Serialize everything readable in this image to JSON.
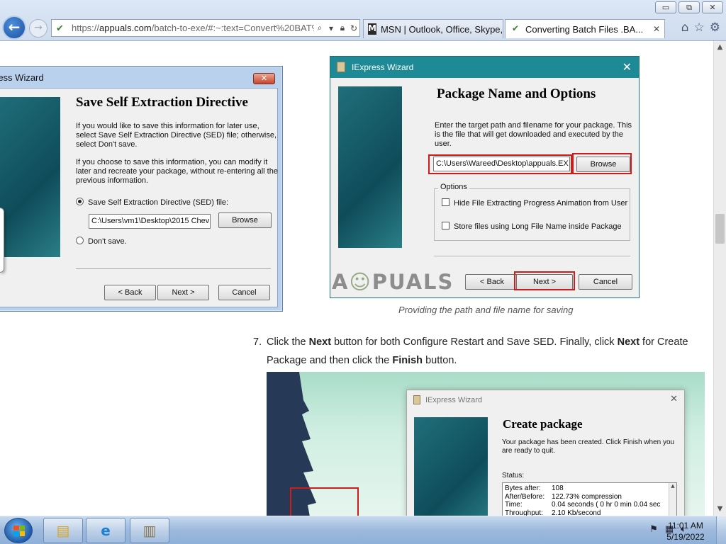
{
  "window_controls": {
    "minimize": "▭",
    "restore": "⧉",
    "close": "✕"
  },
  "browser": {
    "address": {
      "url_prefix": "https://",
      "url_host": "appuals.com",
      "url_rest": "/batch-to-exe/#:~:text=Convert%20BAT%2("
    },
    "tabs": [
      {
        "label": "MSN | Outlook, Office, Skype, ...",
        "icon": "msn-icon"
      },
      {
        "label": "Converting Batch Files .BA...",
        "icon": "appuals-icon",
        "close": "✕"
      }
    ]
  },
  "wizard_left": {
    "title": "ress Wizard",
    "heading": "Save Self Extraction Directive",
    "para1": "If you would like to save this information for later use, select Save Self Extraction Directive (SED) file; otherwise, select Don't save.",
    "para2": "If you choose to save this information, you can modify it later and recreate your package, without re-entering all the previous information.",
    "radio_save": "Save Self Extraction Directive (SED) file:",
    "path_value": "C:\\Users\\vm1\\Desktop\\2015 Chev",
    "browse": "Browse",
    "radio_dont": "Don't save.",
    "back": "< Back",
    "next": "Next >",
    "cancel": "Cancel"
  },
  "wizard_right": {
    "title": "IExpress Wizard",
    "heading": "Package Name and Options",
    "para1": "Enter the target path and filename for your package. This is the file that will get downloaded and executed by the user.",
    "path_value": "C:\\Users\\Wareed\\Desktop\\appuals.EX",
    "browse": "Browse",
    "options_label": "Options",
    "option1": "Hide File Extracting Progress Animation from User",
    "option2": "Store files using Long File Name inside Package",
    "back": "< Back",
    "next": "Next >",
    "cancel": "Cancel"
  },
  "watermark": {
    "a": "A",
    "rest": "PUALS"
  },
  "caption": "Providing the path and file name for saving",
  "step": {
    "number": "7.",
    "t1": "Click the ",
    "b1": "Next",
    "t2": " button for both Configure Restart and Save SED. Finally, click ",
    "b2": "Next",
    "t3": " for Create Package and then click the ",
    "b3": "Finish",
    "t4": " button."
  },
  "wizard_bottom": {
    "title": "IExpress Wizard",
    "heading": "Create package",
    "para1": "Your package has been created.  Click Finish when you are ready to quit.",
    "status_label": "Status:",
    "status_rows": [
      {
        "k": "Bytes after:",
        "v": "108"
      },
      {
        "k": "After/Before:",
        "v": "122.73% compression"
      },
      {
        "k": "Time:",
        "v": "0.04 seconds ( 0 hr  0 min  0.04 sec"
      },
      {
        "k": "Throughput:",
        "v": "2.10 Kb/second"
      }
    ]
  },
  "taskbar": {
    "time": "11:01 AM",
    "date": "5/19/2022"
  }
}
